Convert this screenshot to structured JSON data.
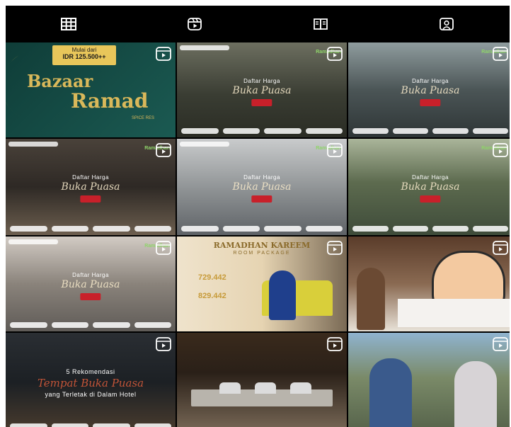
{
  "tabs": [
    {
      "name": "posts",
      "icon": "grid-icon"
    },
    {
      "name": "reels",
      "icon": "reels-icon"
    },
    {
      "name": "guides",
      "icon": "guide-icon"
    },
    {
      "name": "tagged",
      "icon": "tagged-user-icon"
    }
  ],
  "tiles": [
    {
      "id": 1,
      "type": "reel",
      "price_label": "Mulai dari",
      "price": "IDR 125.500++",
      "title_a": "Bazaar",
      "title_b": "Ramad",
      "sub": "SPICE RES",
      "colors": [
        "#0f3d38",
        "#1b5a52"
      ]
    },
    {
      "id": 2,
      "type": "reel",
      "heading": "Daftar Harga",
      "script": "Buka Puasa",
      "brand": "Ramadhan",
      "colors": [
        "#3a3d33",
        "#80836e"
      ]
    },
    {
      "id": 3,
      "type": "reel",
      "heading": "Daftar Harga",
      "script": "Buka Puasa",
      "brand": "Ramadhan",
      "colors": [
        "#3c4344",
        "#7c8d8f"
      ]
    },
    {
      "id": 4,
      "type": "reel",
      "heading": "Daftar Harga",
      "script": "Buka Puasa",
      "brand": "Ramadhan",
      "colors": [
        "#2e2925",
        "#6d5f4f"
      ]
    },
    {
      "id": 5,
      "type": "reel",
      "heading": "Daftar Harga",
      "script": "Buka Puasa",
      "brand": "Ramadhan",
      "colors": [
        "#5e6266",
        "#b9bbbd"
      ]
    },
    {
      "id": 6,
      "type": "reel",
      "heading": "Daftar Harga",
      "script": "Buka Puasa",
      "brand": "Ramadhan",
      "colors": [
        "#3e4b39",
        "#9a9f8a"
      ]
    },
    {
      "id": 7,
      "type": "reel",
      "heading": "Daftar Harga",
      "script": "Buka Puasa",
      "brand": "Ramadhan",
      "colors": [
        "#5f5b57",
        "#bcb2a8"
      ]
    },
    {
      "id": 8,
      "type": "reel",
      "heading": "RAMADHAN KAREEM",
      "sub": "ROOM PACKAGE",
      "price1": "729.442",
      "price2": "829.442",
      "colors": [
        "#e6d4b2",
        "#d8c69a"
      ]
    },
    {
      "id": 9,
      "type": "reel",
      "colors": [
        "#6a4a35",
        "#c8b29a"
      ]
    },
    {
      "id": 10,
      "type": "reel",
      "line1": "5 Rekomendasi",
      "script": "Tempat Buka Puasa",
      "line2": "yang Terletak di Dalam Hotel",
      "colors": [
        "#1c2024",
        "#4a3c2e"
      ]
    },
    {
      "id": 11,
      "type": "reel",
      "colors": [
        "#2a2018",
        "#5a4634"
      ]
    },
    {
      "id": 12,
      "type": "reel",
      "colors": [
        "#5a7f9c",
        "#7a8a68"
      ]
    }
  ]
}
